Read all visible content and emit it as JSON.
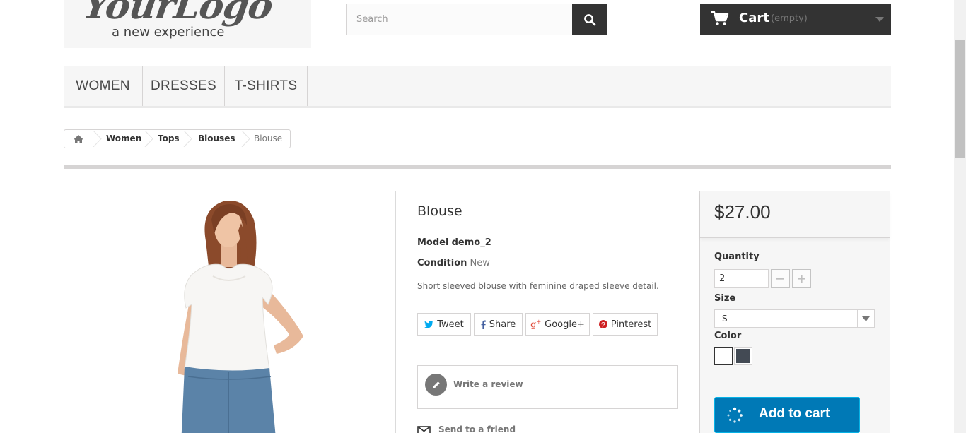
{
  "header": {
    "logo": {
      "script_text": "YourLogo",
      "tagline": "a new experience"
    },
    "search": {
      "placeholder": "Search"
    },
    "cart": {
      "label": "Cart",
      "status": "(empty)"
    }
  },
  "menu": {
    "items": [
      "WOMEN",
      "DRESSES",
      "T-SHIRTS"
    ]
  },
  "breadcrumb": {
    "items": [
      "Women",
      "Tops",
      "Blouses"
    ],
    "current": "Blouse"
  },
  "product": {
    "title": "Blouse",
    "model_label": "Model",
    "model_value": "demo_2",
    "condition_label": "Condition",
    "condition_value": "New",
    "description": "Short sleeved blouse with feminine draped sleeve detail.",
    "share": [
      "Tweet",
      "Share",
      "Google+",
      "Pinterest"
    ],
    "review_label": "Write a review",
    "send_friend_label": "Send to a friend"
  },
  "buy_box": {
    "price": "$27.00",
    "quantity_label": "Quantity",
    "quantity_value": "2",
    "size_label": "Size",
    "size_value": "S",
    "color_label": "Color",
    "colors": [
      "#ffffff",
      "#434a54"
    ],
    "add_to_cart_label": "Add to cart"
  },
  "colors": {
    "accent": "#0079b6",
    "dark": "#333333",
    "panel": "#f6f6f6"
  }
}
